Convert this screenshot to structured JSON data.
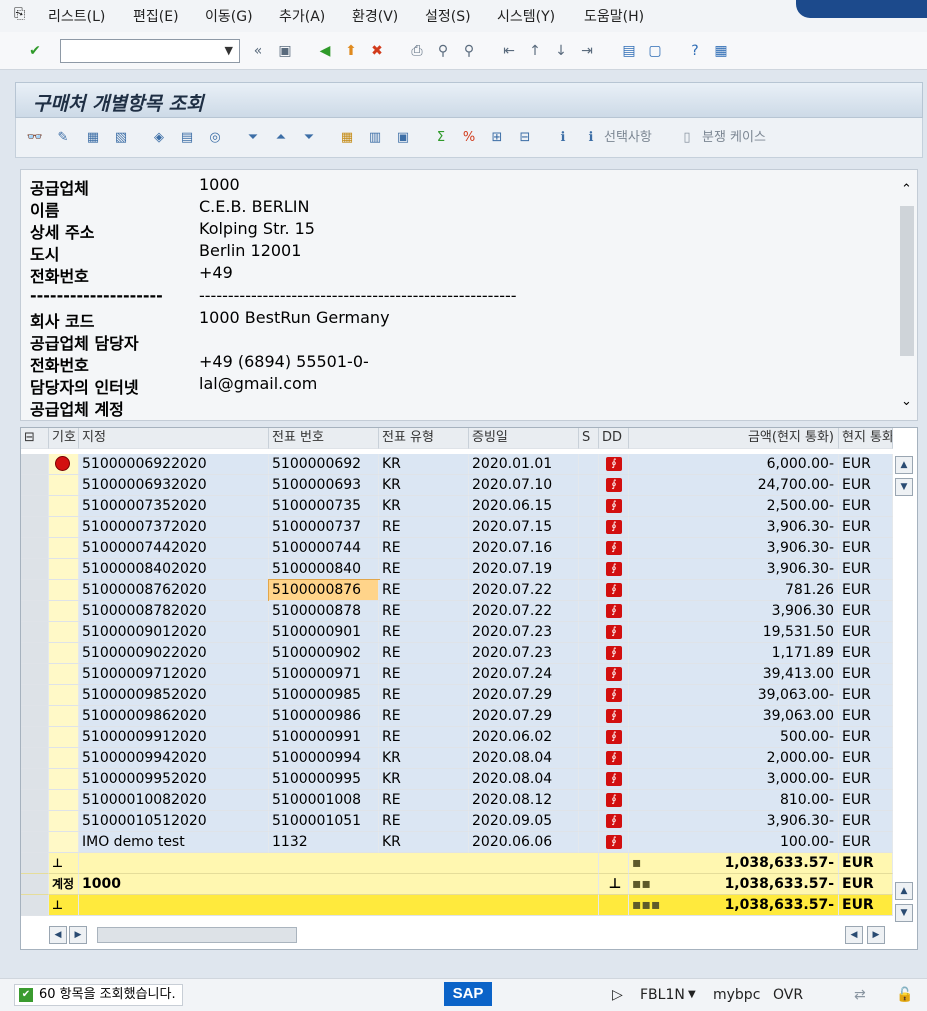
{
  "menu": [
    "리스트(L)",
    "편집(E)",
    "이동(G)",
    "추가(A)",
    "환경(V)",
    "설정(S)",
    "시스템(Y)",
    "도움말(H)"
  ],
  "title": "구매처 개별항목 조회",
  "apptoolbar": {
    "selection_label": "선택사항",
    "split_label": "분쟁 케이스"
  },
  "vendor_header": [
    {
      "label": "공급업체",
      "value": "1000"
    },
    {
      "label": "이름",
      "value": "C.E.B. BERLIN"
    },
    {
      "label": "상세 주소",
      "value": "Kolping Str. 15"
    },
    {
      "label": "도시",
      "value": "Berlin 12001"
    },
    {
      "label": "전화번호",
      "value": "+49"
    },
    {
      "label": "--------------------",
      "value": "-------------------------------------------------------"
    },
    {
      "label": "회사 코드",
      "value": "1000 BestRun Germany"
    },
    {
      "label": "공급업체 담당자",
      "value": ""
    },
    {
      "label": "전화번호",
      "value": "+49 (6894) 55501-0-"
    },
    {
      "label": "담당자의 인터넷",
      "value": "lal@gmail.com"
    },
    {
      "label": "공급업체 계정",
      "value": ""
    }
  ],
  "grid": {
    "columns": [
      "기호",
      "지정",
      "전표 번호",
      "전표 유형",
      "증빙일",
      "S",
      "DD",
      "금액(현지 통화)",
      "현지 통화"
    ],
    "rows": [
      [
        "51000006922020",
        "5100000692",
        "KR",
        "2020.01.01",
        "6,000.00-",
        "EUR"
      ],
      [
        "51000006932020",
        "5100000693",
        "KR",
        "2020.07.10",
        "24,700.00-",
        "EUR"
      ],
      [
        "51000007352020",
        "5100000735",
        "KR",
        "2020.06.15",
        "2,500.00-",
        "EUR"
      ],
      [
        "51000007372020",
        "5100000737",
        "RE",
        "2020.07.15",
        "3,906.30-",
        "EUR"
      ],
      [
        "51000007442020",
        "5100000744",
        "RE",
        "2020.07.16",
        "3,906.30-",
        "EUR"
      ],
      [
        "51000008402020",
        "5100000840",
        "RE",
        "2020.07.19",
        "3,906.30-",
        "EUR"
      ],
      [
        "51000008762020",
        "5100000876",
        "RE",
        "2020.07.22",
        "781.26",
        "EUR"
      ],
      [
        "51000008782020",
        "5100000878",
        "RE",
        "2020.07.22",
        "3,906.30",
        "EUR"
      ],
      [
        "51000009012020",
        "5100000901",
        "RE",
        "2020.07.23",
        "19,531.50",
        "EUR"
      ],
      [
        "51000009022020",
        "5100000902",
        "RE",
        "2020.07.23",
        "1,171.89",
        "EUR"
      ],
      [
        "51000009712020",
        "5100000971",
        "RE",
        "2020.07.24",
        "39,413.00",
        "EUR"
      ],
      [
        "51000009852020",
        "5100000985",
        "RE",
        "2020.07.29",
        "39,063.00-",
        "EUR"
      ],
      [
        "51000009862020",
        "5100000986",
        "RE",
        "2020.07.29",
        "39,063.00",
        "EUR"
      ],
      [
        "51000009912020",
        "5100000991",
        "RE",
        "2020.06.02",
        "500.00-",
        "EUR"
      ],
      [
        "51000009942020",
        "5100000994",
        "KR",
        "2020.08.04",
        "2,000.00-",
        "EUR"
      ],
      [
        "51000009952020",
        "5100000995",
        "KR",
        "2020.08.04",
        "3,000.00-",
        "EUR"
      ],
      [
        "51000010082020",
        "5100001008",
        "RE",
        "2020.08.12",
        "810.00-",
        "EUR"
      ],
      [
        "51000010512020",
        "5100001051",
        "RE",
        "2020.09.05",
        "3,906.30-",
        "EUR"
      ],
      [
        "IMO demo test",
        "1132",
        "KR",
        "2020.06.06",
        "100.00-",
        "EUR"
      ]
    ],
    "highlight_cell": "5100000876",
    "subtotal": {
      "dots": "▪",
      "amount": "1,038,633.57-",
      "currency": "EUR"
    },
    "account_total": {
      "label": "계정",
      "account": "1000",
      "dots": "▪▪",
      "amount": "1,038,633.57-",
      "currency": "EUR"
    },
    "grand_total": {
      "dots": "▪▪▪",
      "amount": "1,038,633.57-",
      "currency": "EUR"
    }
  },
  "status": {
    "message": "60 항목을 조회했습니다.",
    "tcode": "FBL1N",
    "system": "mybpc",
    "mode": "OVR",
    "sap": "SAP"
  },
  "colors": {
    "row_blue": "#dbe6f3",
    "total_yellow": "#ffea3d",
    "dd_red": "#d20f0f",
    "title_bar": "#cddae7"
  }
}
